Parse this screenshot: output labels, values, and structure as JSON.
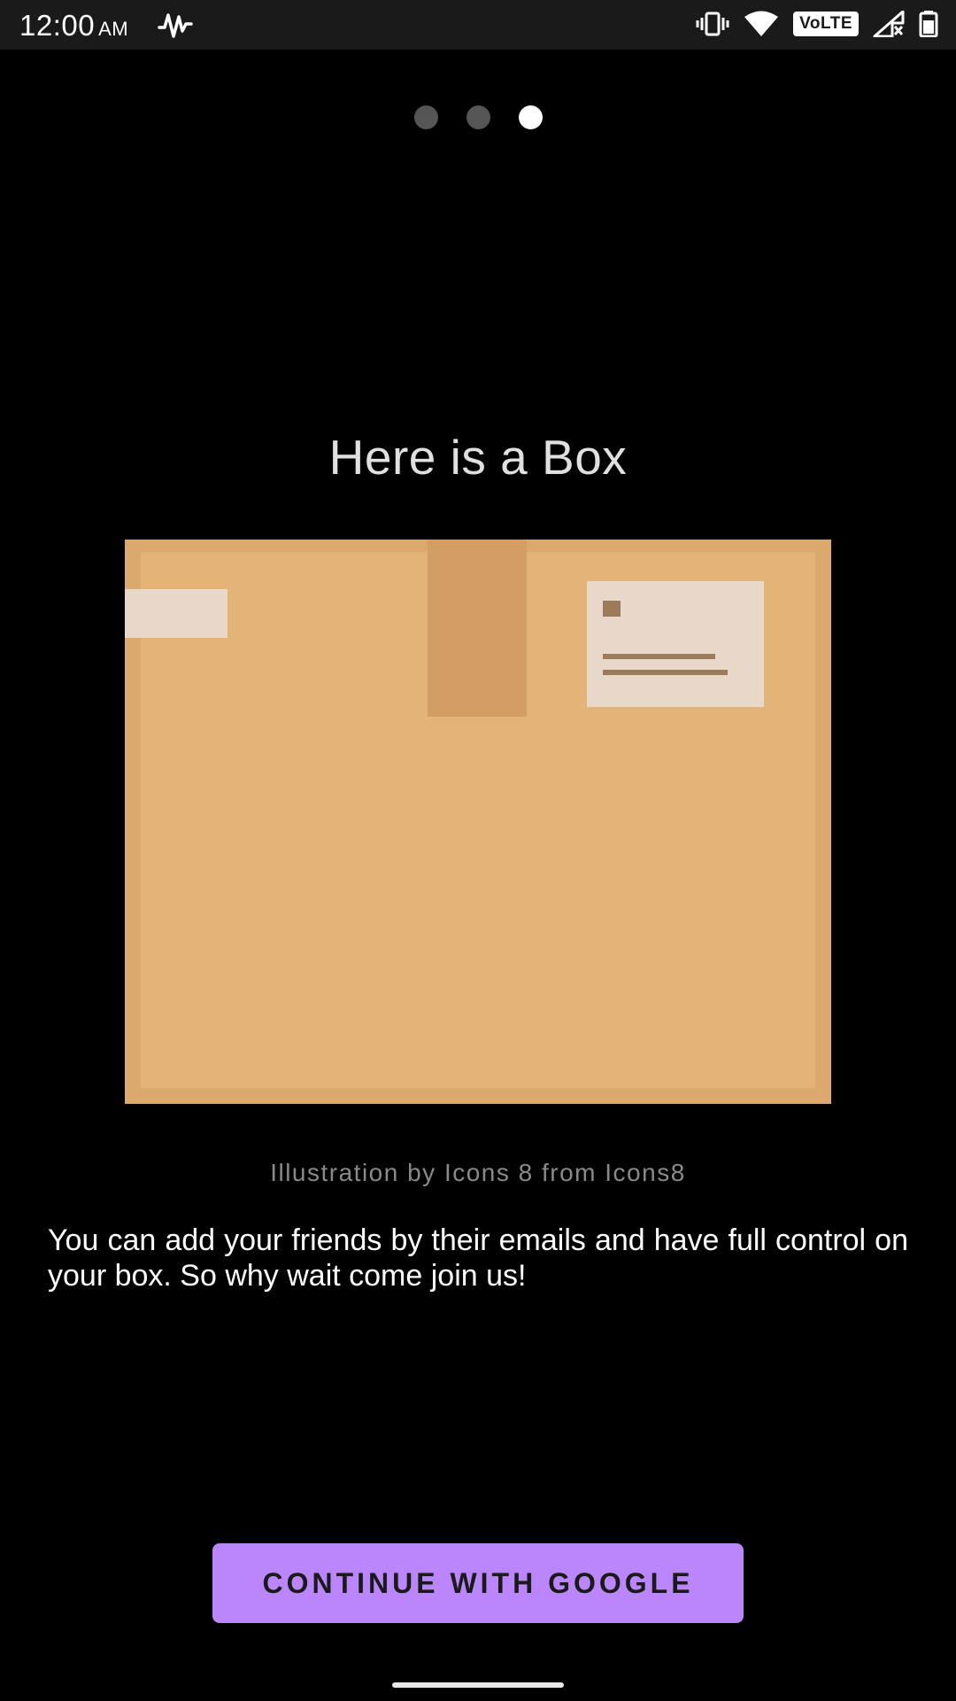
{
  "status_bar": {
    "time": "12:00",
    "time_suffix": "AM",
    "network_badge": "VoLTE",
    "icons": [
      "wave-notification-icon",
      "vibrate-icon",
      "wifi-icon",
      "signal-icon",
      "battery-icon"
    ]
  },
  "pager": {
    "total": 3,
    "active_index": 2
  },
  "onboarding": {
    "title": "Here is a Box",
    "illustration_icon": "cardboard-box-icon",
    "credit": "Illustration by  Icons 8 from  Icons8",
    "description": "You can add your friends by their emails and have full control on your box. So why wait come join us!"
  },
  "actions": {
    "google_button_label": "CONTINUE WITH GOOGLE"
  },
  "colors": {
    "background": "#000000",
    "accent": "#bb86fc",
    "box": "#e4b476",
    "box_edge": "#dba96e",
    "tape": "#d39e66",
    "label": "#e7d8c9",
    "label_ink": "#9b7b5a"
  }
}
